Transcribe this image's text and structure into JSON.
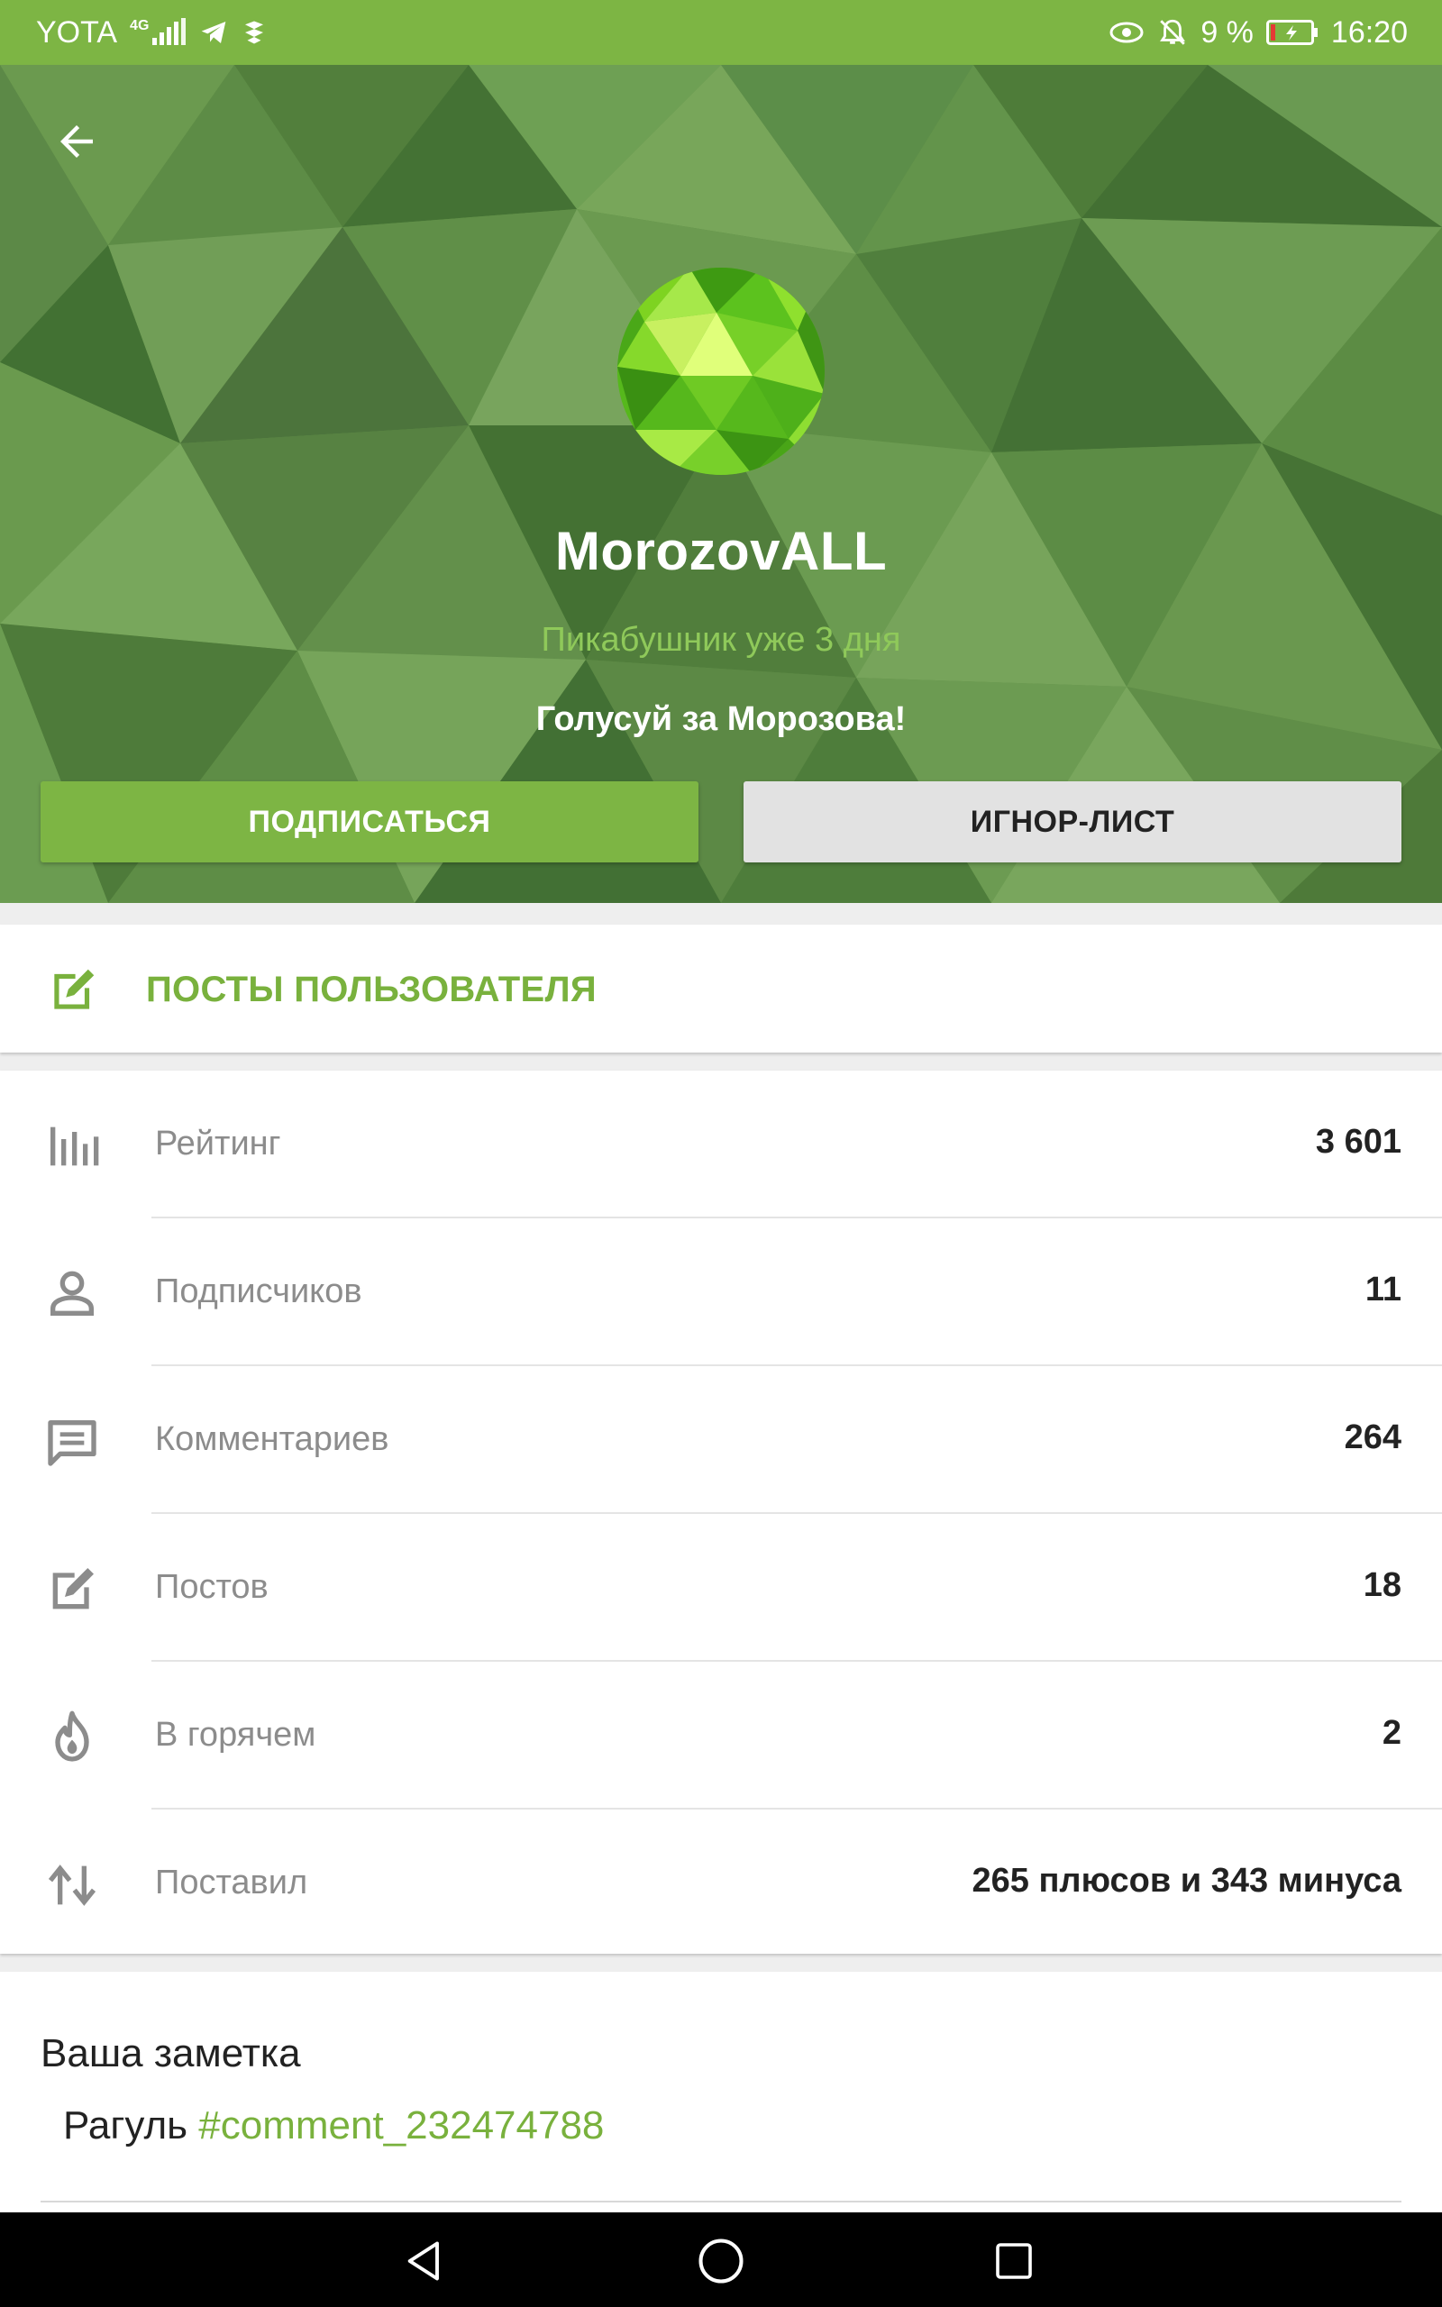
{
  "status_bar": {
    "carrier": "YOTA",
    "network": "4G",
    "battery_percent": "9 %",
    "time": "16:20",
    "icons": [
      "signal-icon",
      "telegram-icon",
      "app-icon",
      "eye-icon",
      "bell-off-icon",
      "battery-icon"
    ]
  },
  "profile": {
    "username": "MorozovALL",
    "tenure": "Пикабушник уже 3 дня",
    "motto": "Голусуй за Морозова!",
    "subscribe_label": "ПОДПИСАТЬСЯ",
    "ignore_label": "ИГНОР-ЛИСТ"
  },
  "posts_link": {
    "label": "ПОСТЫ ПОЛЬЗОВАТЕЛЯ",
    "icon": "edit-icon"
  },
  "stats": [
    {
      "icon": "bar-chart-icon",
      "label": "Рейтинг",
      "value": "3 601"
    },
    {
      "icon": "person-icon",
      "label": "Подписчиков",
      "value": "11"
    },
    {
      "icon": "comment-icon",
      "label": "Комментариев",
      "value": "264"
    },
    {
      "icon": "edit-icon",
      "label": "Постов",
      "value": "18"
    },
    {
      "icon": "fire-icon",
      "label": "В горячем",
      "value": "2"
    },
    {
      "icon": "up-down-arrows-icon",
      "label": "Поставил",
      "value": "265 плюсов и 343 минуса"
    }
  ],
  "note": {
    "title": "Ваша заметка",
    "text": "Рагуль",
    "link": "#comment_232474788"
  },
  "colors": {
    "accent": "#7db544",
    "accent_text": "#79b13d",
    "muted_text": "#8c8c8c"
  }
}
